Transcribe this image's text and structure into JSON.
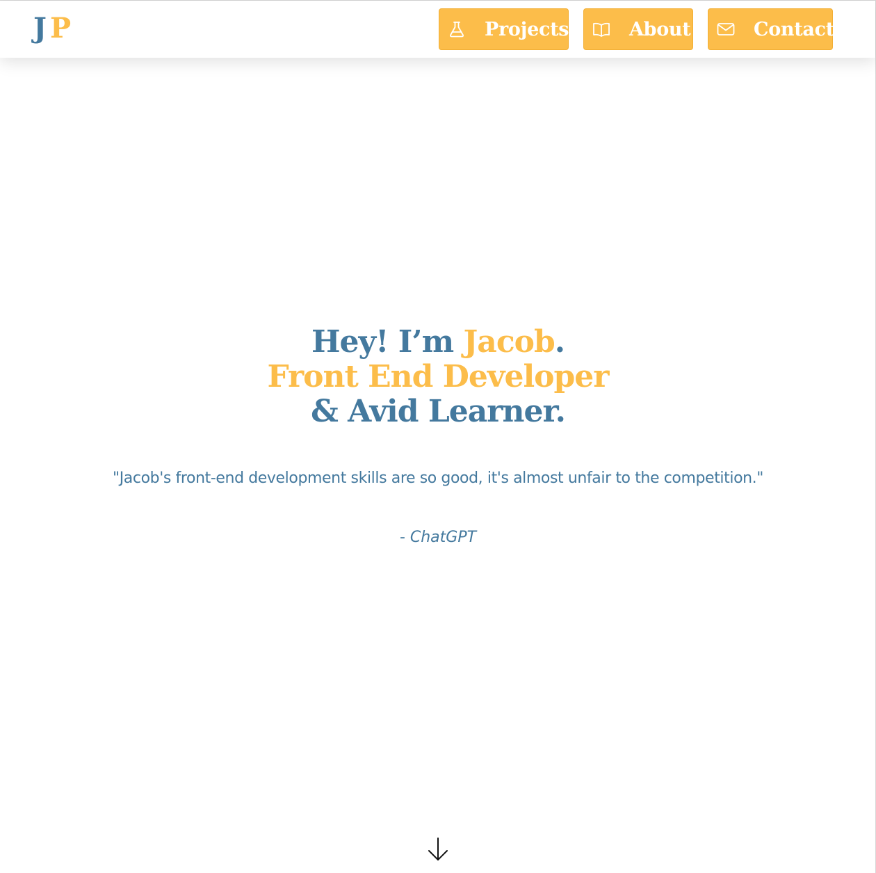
{
  "logo": {
    "first": "J",
    "second": "P"
  },
  "nav": {
    "projects": {
      "label": "Projects",
      "icon": "flask-icon"
    },
    "about": {
      "label": "About",
      "icon": "book-icon"
    },
    "contact": {
      "label": "Contact",
      "icon": "envelope-icon"
    }
  },
  "hero": {
    "line1_a": "Hey! I’m ",
    "line1_name": "Jacob",
    "line1_end": ".",
    "line2": "Front End Developer",
    "line3": "& Avid Learner."
  },
  "quote": {
    "text": "\"Jacob's front-end development skills are so good, it's almost unfair to the competition.\"",
    "author_prefix": "- ",
    "author": "ChatGPT"
  },
  "scroll": {
    "icon": "arrow-down-icon"
  },
  "colors": {
    "blue": "#44799e",
    "gold": "#fcbd4a",
    "background": "#ffffff"
  }
}
